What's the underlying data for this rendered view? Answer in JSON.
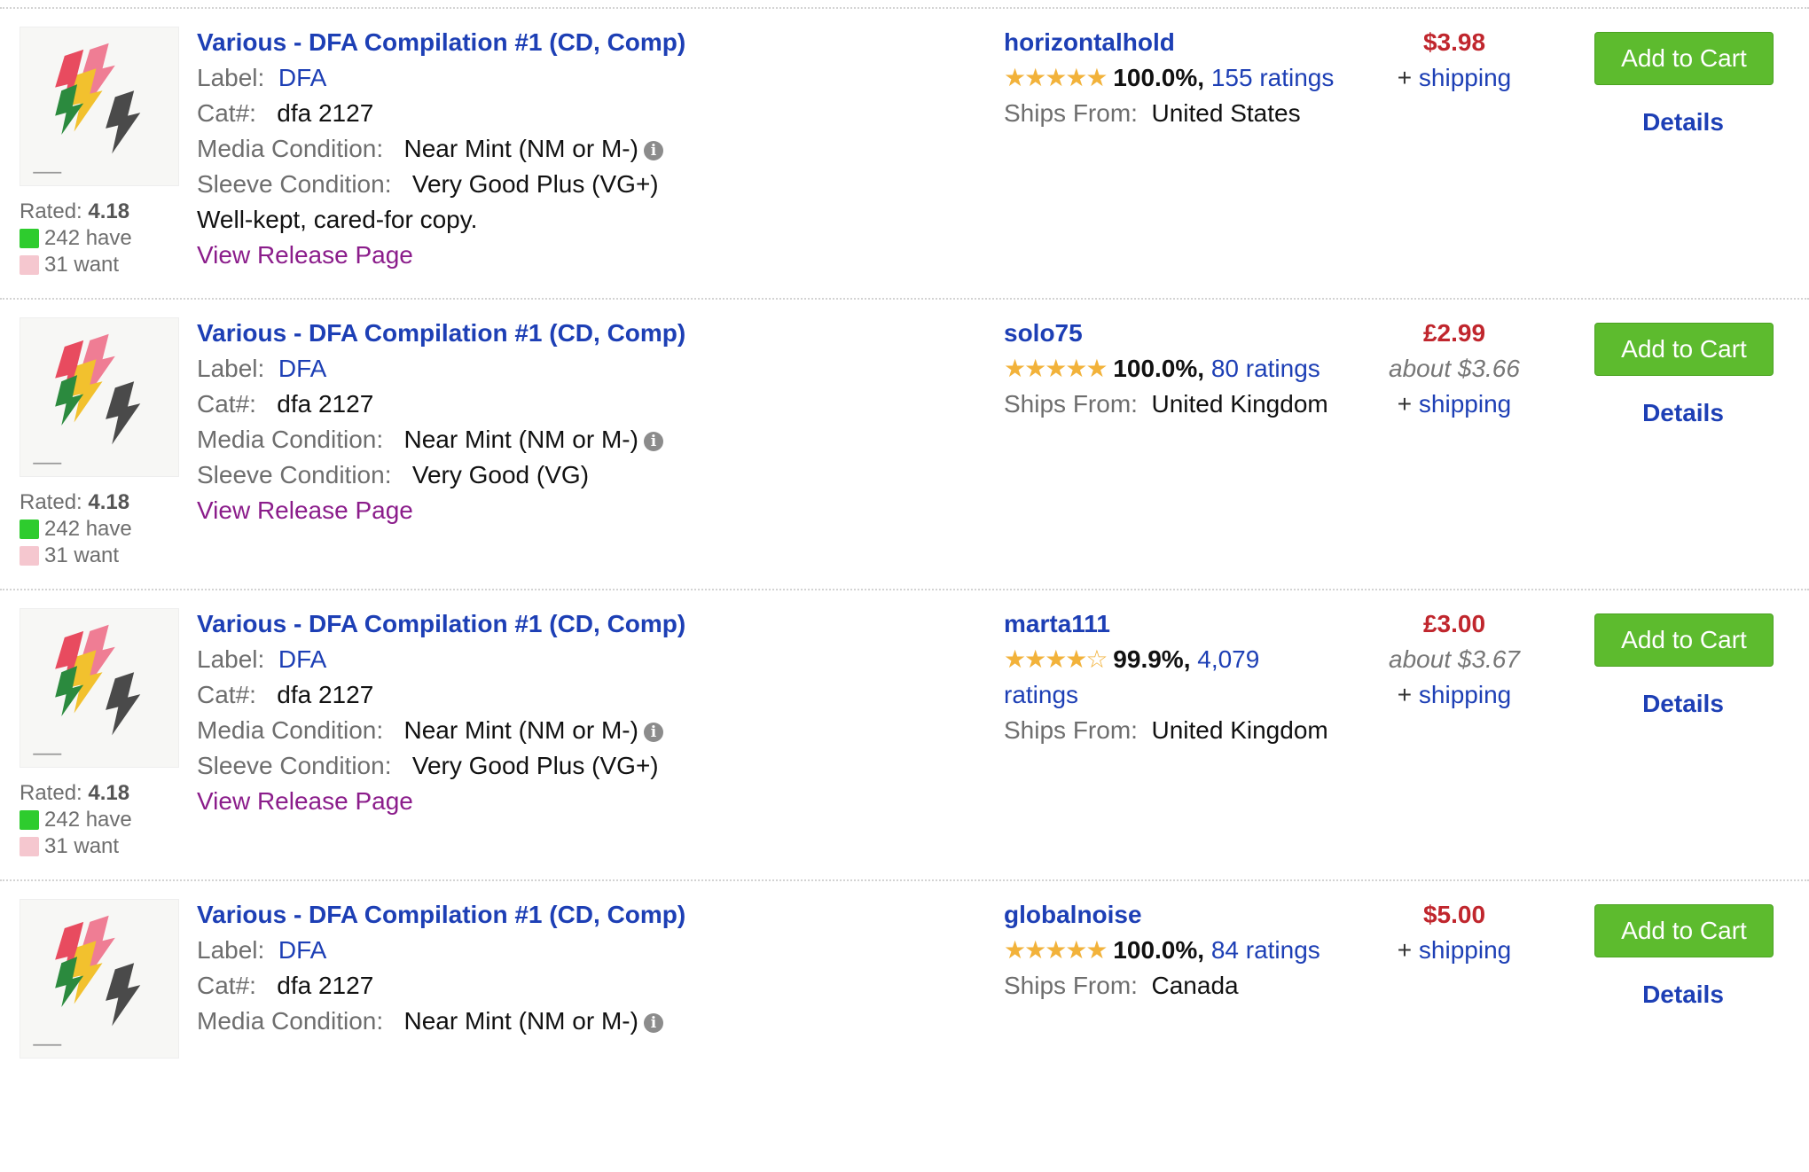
{
  "listings": [
    {
      "title": "Various - DFA Compilation #1 (CD, Comp)",
      "label_caption": "Label:",
      "label": "DFA",
      "cat_caption": "Cat#:",
      "cat": "dfa 2127",
      "media_caption": "Media Condition:",
      "media": "Near Mint (NM or M-)",
      "sleeve_caption": "Sleeve Condition:",
      "sleeve": "Very Good Plus (VG+)",
      "comment": "Well-kept, cared-for copy.",
      "release_link": "View Release Page",
      "rated_caption": "Rated:",
      "rating": "4.18",
      "have": "242 have",
      "want": "31 want",
      "seller": "horizontalhold",
      "stars": "★★★★★",
      "percent": "100.0%,",
      "ratings_link": "155 ratings",
      "ships_caption": "Ships From:",
      "ships_from": "United States",
      "price": "$3.98",
      "approx": "",
      "shipping_prefix": "+ ",
      "shipping_link": "shipping",
      "cart_label": "Add to Cart",
      "details_label": "Details"
    },
    {
      "title": "Various - DFA Compilation #1 (CD, Comp)",
      "label_caption": "Label:",
      "label": "DFA",
      "cat_caption": "Cat#:",
      "cat": "dfa 2127",
      "media_caption": "Media Condition:",
      "media": "Near Mint (NM or M-)",
      "sleeve_caption": "Sleeve Condition:",
      "sleeve": "Very Good (VG)",
      "comment": "",
      "release_link": "View Release Page",
      "rated_caption": "Rated:",
      "rating": "4.18",
      "have": "242 have",
      "want": "31 want",
      "seller": "solo75",
      "stars": "★★★★★",
      "percent": "100.0%,",
      "ratings_link": "80 ratings",
      "ships_caption": "Ships From:",
      "ships_from": "United Kingdom",
      "price": "£2.99",
      "approx": "about $3.66",
      "shipping_prefix": "+ ",
      "shipping_link": "shipping",
      "cart_label": "Add to Cart",
      "details_label": "Details"
    },
    {
      "title": "Various - DFA Compilation #1 (CD, Comp)",
      "label_caption": "Label:",
      "label": "DFA",
      "cat_caption": "Cat#:",
      "cat": "dfa 2127",
      "media_caption": "Media Condition:",
      "media": "Near Mint (NM or M-)",
      "sleeve_caption": "Sleeve Condition:",
      "sleeve": "Very Good Plus (VG+)",
      "comment": "",
      "release_link": "View Release Page",
      "rated_caption": "Rated:",
      "rating": "4.18",
      "have": "242 have",
      "want": "31 want",
      "seller": "marta111",
      "stars": "★★★★☆",
      "percent": "99.9%,",
      "ratings_link": "4,079 ratings",
      "ships_caption": "Ships From:",
      "ships_from": "United Kingdom",
      "price": "£3.00",
      "approx": "about $3.67",
      "shipping_prefix": "+ ",
      "shipping_link": "shipping",
      "cart_label": "Add to Cart",
      "details_label": "Details"
    },
    {
      "title": "Various - DFA Compilation #1 (CD, Comp)",
      "label_caption": "Label:",
      "label": "DFA",
      "cat_caption": "Cat#:",
      "cat": "dfa 2127",
      "media_caption": "Media Condition:",
      "media": "Near Mint (NM or M-)",
      "sleeve_caption": "",
      "sleeve": "",
      "comment": "",
      "release_link": "",
      "rated_caption": "",
      "rating": "",
      "have": "",
      "want": "",
      "seller": "globalnoise",
      "stars": "★★★★★",
      "percent": "100.0%,",
      "ratings_link": "84 ratings",
      "ships_caption": "Ships From:",
      "ships_from": "Canada",
      "price": "$5.00",
      "approx": "",
      "shipping_prefix": "+ ",
      "shipping_link": "shipping",
      "cart_label": "Add to Cart",
      "details_label": "Details"
    }
  ],
  "colors": {
    "title_blue": "#1d3fb5",
    "price_red": "#c0262d",
    "cart_green": "#5dbb2e",
    "star_gold": "#f2b23a",
    "release_purple": "#8b1d8b"
  },
  "icons": {
    "info": "info-circle-icon",
    "have": "have-swatch",
    "want": "want-swatch"
  }
}
